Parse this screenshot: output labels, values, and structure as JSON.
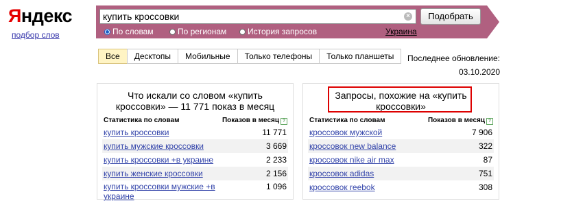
{
  "logo": {
    "first": "Я",
    "rest": "ндекс"
  },
  "sublogo": "подбор слов",
  "search": {
    "value": "купить кроссовки",
    "submit": "Подобрать"
  },
  "radios": [
    "По словам",
    "По регионам",
    "История запросов"
  ],
  "region": "Украина",
  "tabs": [
    "Все",
    "Десктопы",
    "Мобильные",
    "Только телефоны",
    "Только планшеты"
  ],
  "update": {
    "label": "Последнее обновление:",
    "date": "03.10.2020"
  },
  "left": {
    "title": "Что искали со словом «купить кроссовки» — 11 771 показ в месяц",
    "col1": "Статистика по словам",
    "col2": "Показов в месяц",
    "rows": [
      {
        "k": "купить кроссовки",
        "v": "11 771"
      },
      {
        "k": "купить мужские кроссовки",
        "v": "3 669"
      },
      {
        "k": "купить кроссовки +в украине",
        "v": "2 233"
      },
      {
        "k": "купить женские кроссовки",
        "v": "2 156"
      },
      {
        "k": "купить кроссовки мужские +в украине",
        "v": "1 096"
      }
    ]
  },
  "right": {
    "title": "Запросы, похожие на «купить кроссовки»",
    "col1": "Статистика по словам",
    "col2": "Показов в месяц",
    "rows": [
      {
        "k": "кроссовок мужской",
        "v": "7 906"
      },
      {
        "k": "кроссовок new balance",
        "v": "322"
      },
      {
        "k": "кроссовок nike air max",
        "v": "87"
      },
      {
        "k": "кроссовок adidas",
        "v": "751"
      },
      {
        "k": "кроссовок reebok",
        "v": "308"
      }
    ]
  },
  "help_glyph": "?"
}
